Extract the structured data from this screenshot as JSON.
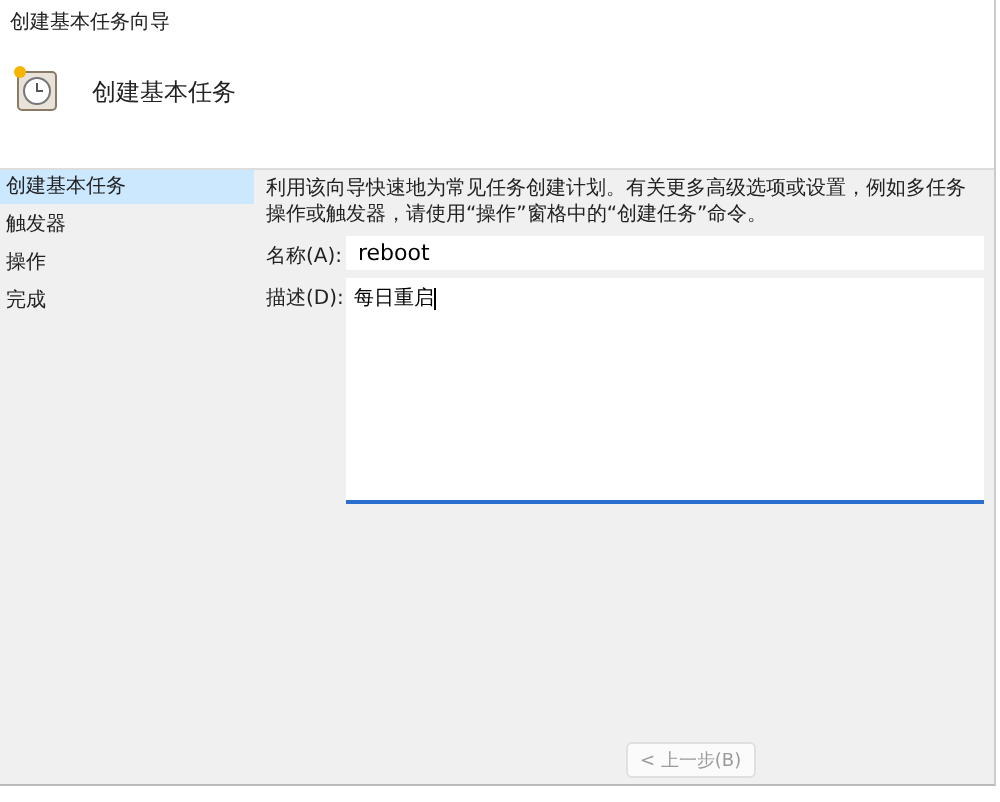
{
  "window": {
    "title": "创建基本任务向导"
  },
  "header": {
    "title": "创建基本任务"
  },
  "steps": [
    {
      "label": "创建基本任务",
      "selected": true
    },
    {
      "label": "触发器",
      "selected": false
    },
    {
      "label": "操作",
      "selected": false
    },
    {
      "label": "完成",
      "selected": false
    }
  ],
  "intro": "利用该向导快速地为常见任务创建计划。有关更多高级选项或设置，例如多任务操作或触发器，请使用“操作”窗格中的“创建任务”命令。",
  "fields": [
    {
      "kind": "line",
      "label": "名称(A):",
      "value": "reboot"
    },
    {
      "kind": "area",
      "label": "描述(D):",
      "value": "每日重启"
    }
  ],
  "buttons": [
    {
      "label": "< 上一步(B)",
      "disabled": true
    }
  ]
}
